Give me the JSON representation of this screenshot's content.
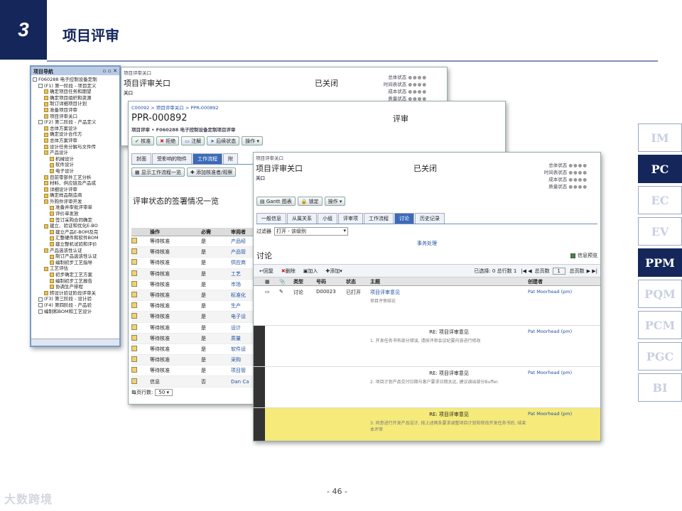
{
  "header": {
    "number": "3",
    "title": "项目评审"
  },
  "nav": {
    "title": "项目导航",
    "items": [
      "F060288 电子控制设备定制",
      "(F1) 第一阶段 - 项目定义",
      "确定项目任务和期望",
      "确定项目组织和资源",
      "制订详细项目计划",
      "准备项目评审",
      "项目评审关口",
      "(F2) 第二阶段 - 产品定义",
      "总体方案设计",
      "确定设计合作方",
      "总体方案评审",
      "设计任务分解与文件传",
      "产品设计",
      "机械设计",
      "软件设计",
      "电子设计",
      "目前零部件工艺分析",
      "材料、供应链及产品成",
      "详细设计评审",
      "确定样品制造商",
      "外购件评审开发",
      "准备并审批评审单",
      "评价单发放",
      "签订采购合同确定",
      "建立、验证和优化E-BO",
      "建立产品E-BOM及完",
      "汇整硬件和软件BOM",
      "建立整机试验和评价",
      "产品选该性认证",
      "制订产品选该性认证",
      "编制初步工艺指导",
      "工艺评估",
      "初步确定工艺方案",
      "编制初步工艺报告",
      "协调生产排程",
      "转设计验证阶段评审关",
      "(F3) 第三阶段 - 设计验",
      "(F4) 第四阶段 - 产品验",
      "编制和BOM和工艺设计"
    ]
  },
  "s1": {
    "crumb": "项目评审关口",
    "title": "项目评审关口",
    "status": "已关闭",
    "sub": "关口",
    "labels": [
      "总体状态",
      "时间表状态",
      "成本状态",
      "质量状态"
    ]
  },
  "s2": {
    "crumb": "C00092 > 项目评审关口 > PPR-000892",
    "id": "PPR-000892",
    "type": "评审",
    "project": "项目评审 • F060288 电子控制设备定制项目评审",
    "buttons": [
      "核准",
      "拒绝",
      "注解",
      "后续状态",
      "操作"
    ],
    "tabs": [
      "封面",
      "受影响的物件",
      "工作流程",
      "附"
    ],
    "actions": [
      "显示工作流程一览",
      "添加核准者/观察"
    ],
    "section": "评审状态的签署情况一览",
    "columns": [
      "操作",
      "必需",
      "审阅者"
    ],
    "rows": [
      [
        "等待核准",
        "是",
        "产品经"
      ],
      [
        "等待核准",
        "是",
        "产品管"
      ],
      [
        "等待核准",
        "是",
        "供应商"
      ],
      [
        "等待核准",
        "是",
        "工艺"
      ],
      [
        "等待核准",
        "是",
        "市场"
      ],
      [
        "等待核准",
        "是",
        "标准化"
      ],
      [
        "等待核准",
        "是",
        "生产"
      ],
      [
        "等待核准",
        "是",
        "电子设"
      ],
      [
        "等待核准",
        "是",
        "设计"
      ],
      [
        "等待核准",
        "是",
        "质量"
      ],
      [
        "等待核准",
        "是",
        "软件设"
      ],
      [
        "等待核准",
        "是",
        "采购"
      ],
      [
        "等待核准",
        "是",
        "项目管"
      ],
      [
        "信息",
        "否",
        "Dan Ca"
      ]
    ],
    "pager_label": "每页行数:",
    "pager_value": "50"
  },
  "s3": {
    "crumb": "项目评审关口",
    "title": "项目评审关口",
    "status": "已关闭",
    "sub": "关口",
    "labels": [
      "总体状态",
      "时间表状态",
      "成本状态",
      "质量状态"
    ],
    "buttons": [
      "Gantt 图表",
      "锁定",
      "操作"
    ],
    "tabs": [
      "一般信息",
      "从属关系",
      "小组",
      "评审项",
      "工作流程",
      "讨论",
      "历史记录"
    ],
    "filter_label": "过滤器",
    "filter_value": "打开 - 该级别",
    "event_link": "事务处理",
    "section": "讨论",
    "preview": "信息预览",
    "toolbar": [
      "回复",
      "删除",
      "加入",
      "添加"
    ],
    "selected": "已选择: 0 总行数 1",
    "page_label": "总页数",
    "page_value": "1",
    "columns": [
      "类型",
      "号码",
      "状态",
      "主题",
      "创建者"
    ],
    "rows": [
      {
        "type": "讨论",
        "num": "D00023",
        "status": "已打开",
        "subject": "项目评审意见",
        "detail": "项目评审结论",
        "creator": "Pat Moorhead (pm)"
      },
      {
        "type": "",
        "num": "",
        "status": "",
        "subject": "RE: 项目评审意见",
        "detail": "1. 开发任务书有部分错误, 请按评审会议纪要内容进行修改",
        "creator": "Pat Moorhead (pm)"
      },
      {
        "type": "",
        "num": "",
        "status": "",
        "subject": "RE: 项目评审意见",
        "detail": "2. 项目计划产品交付日期与客户要求日期太远, 建议调出部分Buffer.",
        "creator": "Pat Moorhead (pm)"
      },
      {
        "type": "",
        "num": "",
        "status": "",
        "subject": "RE: 项目评审意见",
        "detail": "3. 同意进行开发产品设计, 按上述两条要求调整项目计划和修改开发任务书后, 结束本评审",
        "creator": "Pat Moorhead (pm)"
      }
    ]
  },
  "sidenav": [
    "IM",
    "PC",
    "EC",
    "EV",
    "PPM",
    "PQM",
    "PCM",
    "PGC",
    "BI"
  ],
  "sidenav_active": [
    "PC",
    "PPM"
  ],
  "footer": {
    "page": "- 46 -",
    "watermark": "大数跨境"
  }
}
